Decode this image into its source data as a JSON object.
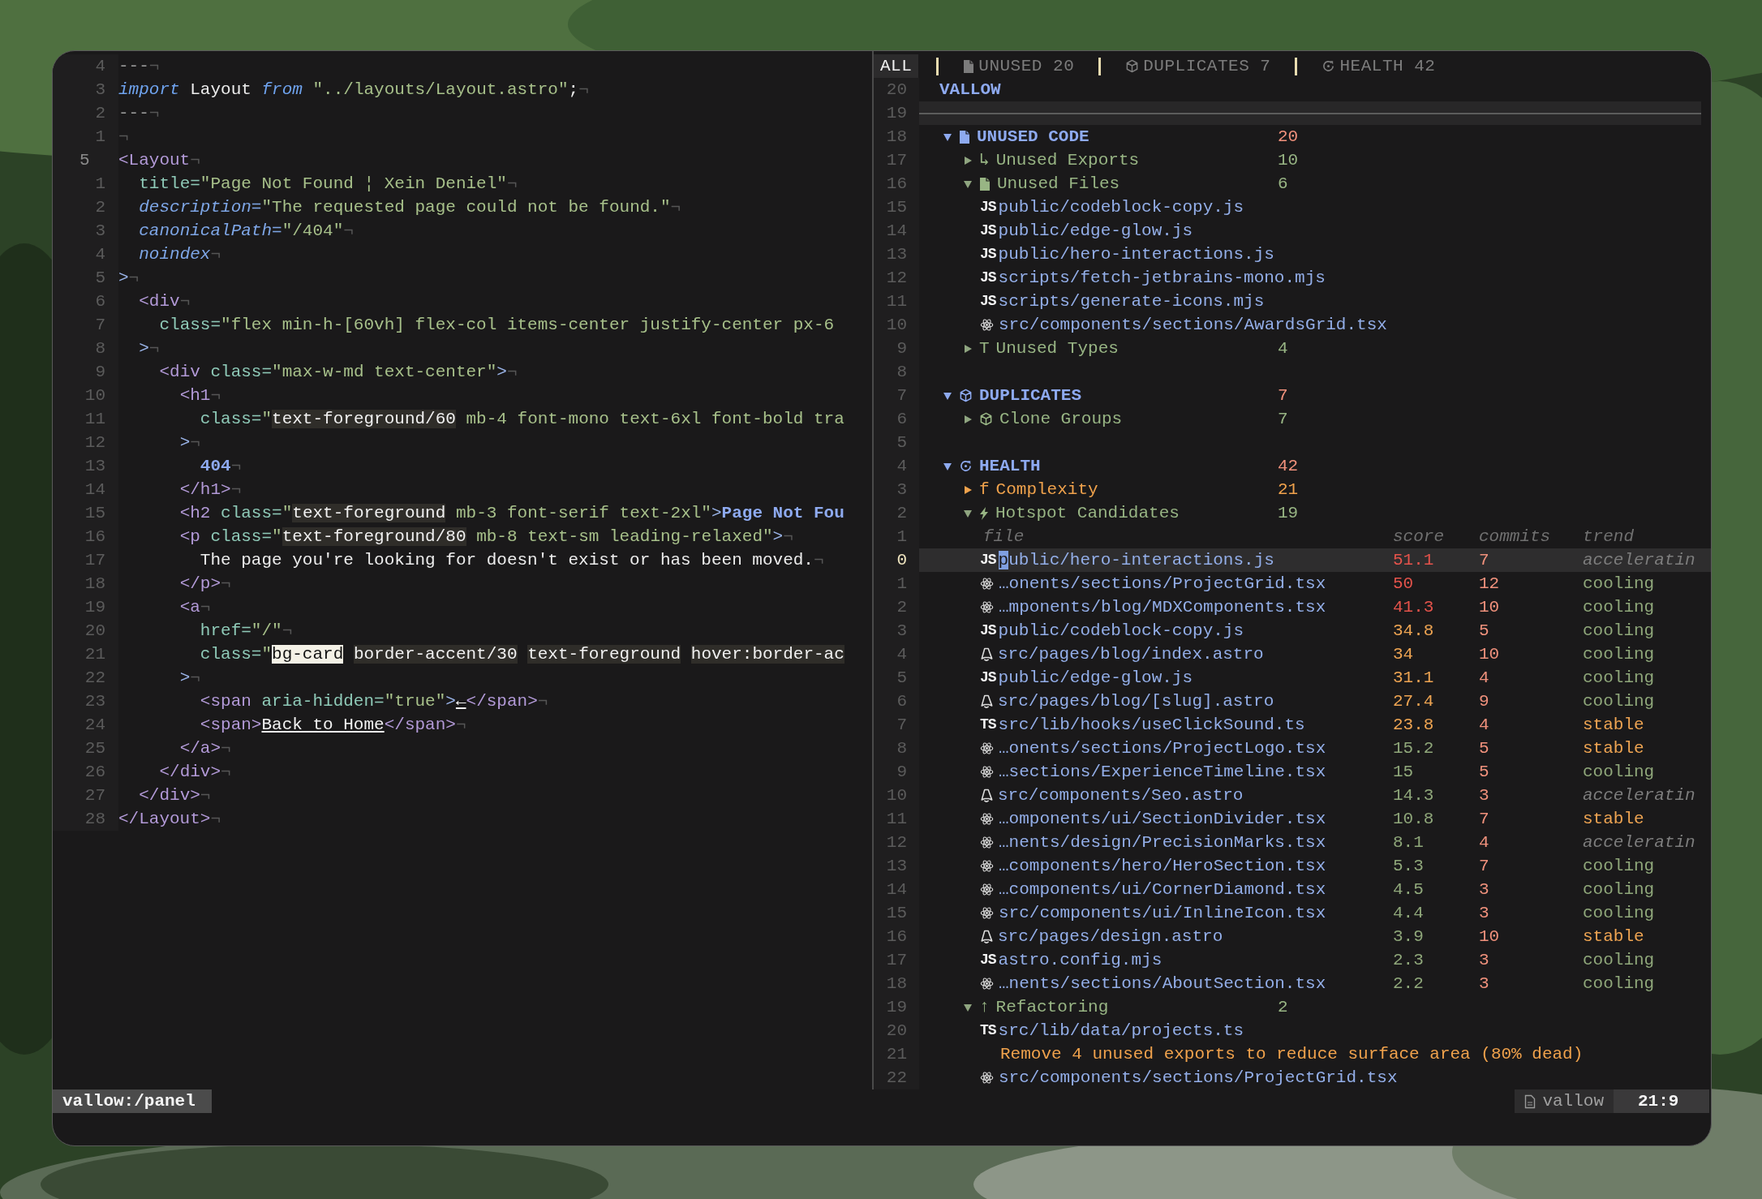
{
  "editor": {
    "lines": [
      {
        "n": "4",
        "current": false,
        "tokens": [
          {
            "text": "---",
            "kind": "dim"
          },
          {
            "text": "¬",
            "kind": "eol"
          }
        ]
      },
      {
        "n": "3",
        "current": false,
        "tokens": [
          {
            "text": "import",
            "kind": "kw"
          },
          {
            "text": " Layout ",
            "kind": "id"
          },
          {
            "text": "from",
            "kind": "kw"
          },
          {
            "text": " \"../layouts/Layout.astro\"",
            "kind": "str"
          },
          {
            "text": ";",
            "kind": "id"
          },
          {
            "text": "¬",
            "kind": "eol"
          }
        ]
      },
      {
        "n": "2",
        "current": false,
        "tokens": [
          {
            "text": "---",
            "kind": "dim"
          },
          {
            "text": "¬",
            "kind": "eol"
          }
        ]
      },
      {
        "n": "1",
        "current": false,
        "tokens": [
          {
            "text": "¬",
            "kind": "eol"
          }
        ]
      },
      {
        "n": "5",
        "current": true,
        "tokens": [
          {
            "text": "<Layout",
            "kind": "tag"
          },
          {
            "text": "¬",
            "kind": "eol"
          }
        ]
      },
      {
        "n": "1",
        "current": false,
        "tokens": [
          {
            "text": "  title=",
            "kind": "attr"
          },
          {
            "text": "\"Page Not Found ¦ Xein Deniel\"",
            "kind": "str"
          },
          {
            "text": "¬",
            "kind": "eol"
          }
        ]
      },
      {
        "n": "2",
        "current": false,
        "tokens": [
          {
            "text": "  description=",
            "kind": "attri"
          },
          {
            "text": "\"The requested page could not be found.\"",
            "kind": "str"
          },
          {
            "text": "¬",
            "kind": "eol"
          }
        ]
      },
      {
        "n": "3",
        "current": false,
        "tokens": [
          {
            "text": "  canonicalPath=",
            "kind": "attri"
          },
          {
            "text": "\"/404\"",
            "kind": "str"
          },
          {
            "text": "¬",
            "kind": "eol"
          }
        ]
      },
      {
        "n": "4",
        "current": false,
        "tokens": [
          {
            "text": "  noindex",
            "kind": "attri"
          },
          {
            "text": "¬",
            "kind": "eol"
          }
        ]
      },
      {
        "n": "5",
        "current": false,
        "tokens": [
          {
            "text": ">",
            "kind": "pun"
          },
          {
            "text": "¬",
            "kind": "eol"
          }
        ]
      },
      {
        "n": "6",
        "current": false,
        "tokens": [
          {
            "text": "  <div",
            "kind": "tag"
          },
          {
            "text": "¬",
            "kind": "eol"
          }
        ]
      },
      {
        "n": "7",
        "current": false,
        "tokens": [
          {
            "text": "    class=",
            "kind": "attr"
          },
          {
            "text": "\"flex min-h-[60vh] flex-col items-center justify-center px-6",
            "kind": "str"
          }
        ]
      },
      {
        "n": "8",
        "current": false,
        "tokens": [
          {
            "text": "  >",
            "kind": "pun"
          },
          {
            "text": "¬",
            "kind": "eol"
          }
        ]
      },
      {
        "n": "9",
        "current": false,
        "tokens": [
          {
            "text": "    <div",
            "kind": "tag"
          },
          {
            "text": " class=",
            "kind": "attr"
          },
          {
            "text": "\"max-w-md text-center\"",
            "kind": "str"
          },
          {
            "text": ">",
            "kind": "pun"
          },
          {
            "text": "¬",
            "kind": "eol"
          }
        ]
      },
      {
        "n": "10",
        "current": false,
        "tokens": [
          {
            "text": "      <h1",
            "kind": "tag"
          },
          {
            "text": "¬",
            "kind": "eol"
          }
        ]
      },
      {
        "n": "11",
        "current": false,
        "tokens": [
          {
            "text": "        class=",
            "kind": "attr"
          },
          {
            "text": "\"",
            "kind": "str"
          },
          {
            "text": "text-foreground/60",
            "kind": "hl"
          },
          {
            "text": " mb-4 font-mono text-6xl font-bold tra",
            "kind": "str"
          }
        ]
      },
      {
        "n": "12",
        "current": false,
        "tokens": [
          {
            "text": "      >",
            "kind": "pun"
          },
          {
            "text": "¬",
            "kind": "eol"
          }
        ]
      },
      {
        "n": "13",
        "current": false,
        "tokens": [
          {
            "text": "        404",
            "kind": "num"
          },
          {
            "text": "¬",
            "kind": "eol"
          }
        ]
      },
      {
        "n": "14",
        "current": false,
        "tokens": [
          {
            "text": "      </h1>",
            "kind": "tag"
          },
          {
            "text": "¬",
            "kind": "eol"
          }
        ]
      },
      {
        "n": "15",
        "current": false,
        "tokens": [
          {
            "text": "      <h2",
            "kind": "tag"
          },
          {
            "text": " class=",
            "kind": "attr"
          },
          {
            "text": "\"",
            "kind": "str"
          },
          {
            "text": "text-foreground",
            "kind": "hl"
          },
          {
            "text": " mb-3 font-serif text-2xl\"",
            "kind": "str"
          },
          {
            "text": ">",
            "kind": "pun"
          },
          {
            "text": "Page Not Fou",
            "kind": "num"
          }
        ]
      },
      {
        "n": "16",
        "current": false,
        "tokens": [
          {
            "text": "      <p",
            "kind": "tag"
          },
          {
            "text": " class=",
            "kind": "attr"
          },
          {
            "text": "\"",
            "kind": "str"
          },
          {
            "text": "text-foreground/80",
            "kind": "hl"
          },
          {
            "text": " mb-8 text-sm leading-relaxed\"",
            "kind": "str"
          },
          {
            "text": ">",
            "kind": "pun"
          },
          {
            "text": "¬",
            "kind": "eol"
          }
        ]
      },
      {
        "n": "17",
        "current": false,
        "tokens": [
          {
            "text": "        The page you're looking for doesn't exist or has been moved.",
            "kind": "txt"
          },
          {
            "text": "¬",
            "kind": "eol"
          }
        ]
      },
      {
        "n": "18",
        "current": false,
        "tokens": [
          {
            "text": "      </p>",
            "kind": "tag"
          },
          {
            "text": "¬",
            "kind": "eol"
          }
        ]
      },
      {
        "n": "19",
        "current": false,
        "tokens": [
          {
            "text": "      <a",
            "kind": "tag"
          },
          {
            "text": "¬",
            "kind": "eol"
          }
        ]
      },
      {
        "n": "20",
        "current": false,
        "tokens": [
          {
            "text": "        href=",
            "kind": "attr"
          },
          {
            "text": "\"/\"",
            "kind": "str"
          },
          {
            "text": "¬",
            "kind": "eol"
          }
        ]
      },
      {
        "n": "21",
        "current": false,
        "tokens": [
          {
            "text": "        class=",
            "kind": "attr"
          },
          {
            "text": "\"",
            "kind": "str"
          },
          {
            "text": "bg-card ",
            "kind": "hlw"
          },
          {
            "text": "border-accent/30 ",
            "kind": "hl"
          },
          {
            "text": "text-foreground ",
            "kind": "hl"
          },
          {
            "text": "hover:border-ac",
            "kind": "hl"
          }
        ]
      },
      {
        "n": "22",
        "current": false,
        "tokens": [
          {
            "text": "      >",
            "kind": "pun"
          },
          {
            "text": "¬",
            "kind": "eol"
          }
        ]
      },
      {
        "n": "23",
        "current": false,
        "tokens": [
          {
            "text": "        <span",
            "kind": "tag"
          },
          {
            "text": " aria-hidden=",
            "kind": "attr"
          },
          {
            "text": "\"true\"",
            "kind": "str"
          },
          {
            "text": ">",
            "kind": "pun"
          },
          {
            "text": "←",
            "kind": "u"
          },
          {
            "text": "</span>",
            "kind": "tag"
          },
          {
            "text": "¬",
            "kind": "eol"
          }
        ]
      },
      {
        "n": "24",
        "current": false,
        "tokens": [
          {
            "text": "        <span>",
            "kind": "tag"
          },
          {
            "text": "Back to Home",
            "kind": "u"
          },
          {
            "text": "</span>",
            "kind": "tag"
          },
          {
            "text": "¬",
            "kind": "eol"
          }
        ]
      },
      {
        "n": "25",
        "current": false,
        "tokens": [
          {
            "text": "      </a>",
            "kind": "tag"
          },
          {
            "text": "¬",
            "kind": "eol"
          }
        ]
      },
      {
        "n": "26",
        "current": false,
        "tokens": [
          {
            "text": "    </div>",
            "kind": "tag"
          },
          {
            "text": "¬",
            "kind": "eol"
          }
        ]
      },
      {
        "n": "27",
        "current": false,
        "tokens": [
          {
            "text": "  </div>",
            "kind": "tag"
          },
          {
            "text": "¬",
            "kind": "eol"
          }
        ]
      },
      {
        "n": "28",
        "current": false,
        "tokens": [
          {
            "text": "</Layout>",
            "kind": "tag"
          },
          {
            "text": "¬",
            "kind": "eol"
          }
        ]
      }
    ]
  },
  "panel": {
    "tabs": [
      {
        "kind": "all",
        "label": "ALL",
        "selected": true
      },
      {
        "kind": "unused",
        "label": "UNUSED 20",
        "selected": false
      },
      {
        "kind": "duplicates",
        "label": "DUPLICATES 7",
        "selected": false
      },
      {
        "kind": "health",
        "label": "HEALTH 42",
        "selected": false
      }
    ],
    "rows": [
      {
        "n": "20",
        "kind": "title",
        "text": "VALLOW"
      },
      {
        "n": "19",
        "kind": "rule"
      },
      {
        "n": "18",
        "kind": "section",
        "icon": {
          "kind": "file"
        },
        "label": "UNUSED CODE",
        "count": "20",
        "expanded": true
      },
      {
        "n": "17",
        "kind": "group",
        "icon": {
          "kind": "glyph",
          "text": "↳"
        },
        "label": "Unused Exports",
        "count": "10",
        "expanded": false,
        "warning": false
      },
      {
        "n": "16",
        "kind": "group",
        "icon": {
          "kind": "file"
        },
        "label": "Unused Files",
        "count": "6",
        "expanded": true,
        "warning": false
      },
      {
        "n": "15",
        "kind": "file",
        "icon": {
          "kind": "badge",
          "text": "JS"
        },
        "path": "public/codeblock-copy.js"
      },
      {
        "n": "14",
        "kind": "file",
        "icon": {
          "kind": "badge",
          "text": "JS"
        },
        "path": "public/edge-glow.js"
      },
      {
        "n": "13",
        "kind": "file",
        "icon": {
          "kind": "badge",
          "text": "JS"
        },
        "path": "public/hero-interactions.js"
      },
      {
        "n": "12",
        "kind": "file",
        "icon": {
          "kind": "badge",
          "text": "JS"
        },
        "path": "scripts/fetch-jetbrains-mono.mjs"
      },
      {
        "n": "11",
        "kind": "file",
        "icon": {
          "kind": "badge",
          "text": "JS"
        },
        "path": "scripts/generate-icons.mjs"
      },
      {
        "n": "10",
        "kind": "file",
        "icon": {
          "kind": "react"
        },
        "path": "src/components/sections/AwardsGrid.tsx"
      },
      {
        "n": "9",
        "kind": "group",
        "icon": {
          "kind": "glyph",
          "text": "T"
        },
        "label": "Unused Types",
        "count": "4",
        "expanded": false,
        "warning": false
      },
      {
        "n": "8",
        "kind": "blank"
      },
      {
        "n": "7",
        "kind": "section",
        "icon": {
          "kind": "cube"
        },
        "label": "DUPLICATES",
        "count": "7",
        "expanded": true
      },
      {
        "n": "6",
        "kind": "group",
        "icon": {
          "kind": "cube"
        },
        "label": "Clone Groups",
        "count": "7",
        "expanded": false,
        "warning": false
      },
      {
        "n": "5",
        "kind": "blank"
      },
      {
        "n": "4",
        "kind": "section",
        "icon": {
          "kind": "health"
        },
        "label": "HEALTH",
        "count": "42",
        "expanded": true
      },
      {
        "n": "3",
        "kind": "group",
        "icon": {
          "kind": "glyph",
          "text": "f"
        },
        "label": "Complexity",
        "count": "21",
        "expanded": false,
        "warning": true
      },
      {
        "n": "2",
        "kind": "group",
        "icon": {
          "kind": "bolt"
        },
        "label": "Hotspot Candidates",
        "count": "19",
        "expanded": true,
        "warning": false
      },
      {
        "n": "1",
        "kind": "header",
        "columns": [
          "file",
          "score",
          "commits",
          "trend"
        ]
      },
      {
        "n": "0",
        "kind": "hotspot",
        "selected": true,
        "icon": {
          "kind": "badge",
          "text": "JS"
        },
        "path": "public/hero-interactions.js",
        "score": {
          "text": "51.1",
          "kind": "high"
        },
        "commits": "7",
        "trend": {
          "text": "acceleratin",
          "kind": "rising"
        }
      },
      {
        "n": "1",
        "kind": "hotspot",
        "selected": false,
        "icon": {
          "kind": "react"
        },
        "path": "…onents/sections/ProjectGrid.tsx",
        "score": {
          "text": "50",
          "kind": "high"
        },
        "commits": "12",
        "trend": {
          "text": "cooling",
          "kind": "falling"
        }
      },
      {
        "n": "2",
        "kind": "hotspot",
        "selected": false,
        "icon": {
          "kind": "react"
        },
        "path": "…mponents/blog/MDXComponents.tsx",
        "score": {
          "text": "41.3",
          "kind": "high"
        },
        "commits": "10",
        "trend": {
          "text": "cooling",
          "kind": "falling"
        }
      },
      {
        "n": "3",
        "kind": "hotspot",
        "selected": false,
        "icon": {
          "kind": "badge",
          "text": "JS"
        },
        "path": "public/codeblock-copy.js",
        "score": {
          "text": "34.8",
          "kind": "medium"
        },
        "commits": "5",
        "trend": {
          "text": "cooling",
          "kind": "falling"
        }
      },
      {
        "n": "4",
        "kind": "hotspot",
        "selected": false,
        "icon": {
          "kind": "astro"
        },
        "path": "src/pages/blog/index.astro",
        "score": {
          "text": "34",
          "kind": "medium"
        },
        "commits": "10",
        "trend": {
          "text": "cooling",
          "kind": "falling"
        }
      },
      {
        "n": "5",
        "kind": "hotspot",
        "selected": false,
        "icon": {
          "kind": "badge",
          "text": "JS"
        },
        "path": "public/edge-glow.js",
        "score": {
          "text": "31.1",
          "kind": "medium"
        },
        "commits": "4",
        "trend": {
          "text": "cooling",
          "kind": "falling"
        }
      },
      {
        "n": "6",
        "kind": "hotspot",
        "selected": false,
        "icon": {
          "kind": "astro"
        },
        "path": "src/pages/blog/[slug].astro",
        "score": {
          "text": "27.4",
          "kind": "medium"
        },
        "commits": "9",
        "trend": {
          "text": "cooling",
          "kind": "falling"
        }
      },
      {
        "n": "7",
        "kind": "hotspot",
        "selected": false,
        "icon": {
          "kind": "badge",
          "text": "TS"
        },
        "path": "src/lib/hooks/useClickSound.ts",
        "score": {
          "text": "23.8",
          "kind": "medium"
        },
        "commits": "4",
        "trend": {
          "text": "stable",
          "kind": "flat"
        }
      },
      {
        "n": "8",
        "kind": "hotspot",
        "selected": false,
        "icon": {
          "kind": "react"
        },
        "path": "…onents/sections/ProjectLogo.tsx",
        "score": {
          "text": "15.2",
          "kind": "low"
        },
        "commits": "5",
        "trend": {
          "text": "stable",
          "kind": "flat"
        }
      },
      {
        "n": "9",
        "kind": "hotspot",
        "selected": false,
        "icon": {
          "kind": "react"
        },
        "path": "…sections/ExperienceTimeline.tsx",
        "score": {
          "text": "15",
          "kind": "low"
        },
        "commits": "5",
        "trend": {
          "text": "cooling",
          "kind": "falling"
        }
      },
      {
        "n": "10",
        "kind": "hotspot",
        "selected": false,
        "icon": {
          "kind": "astro"
        },
        "path": "src/components/Seo.astro",
        "score": {
          "text": "14.3",
          "kind": "low"
        },
        "commits": "3",
        "trend": {
          "text": "acceleratin",
          "kind": "rising"
        }
      },
      {
        "n": "11",
        "kind": "hotspot",
        "selected": false,
        "icon": {
          "kind": "react"
        },
        "path": "…omponents/ui/SectionDivider.tsx",
        "score": {
          "text": "10.8",
          "kind": "low"
        },
        "commits": "7",
        "trend": {
          "text": "stable",
          "kind": "flat"
        }
      },
      {
        "n": "12",
        "kind": "hotspot",
        "selected": false,
        "icon": {
          "kind": "react"
        },
        "path": "…nents/design/PrecisionMarks.tsx",
        "score": {
          "text": "8.1",
          "kind": "low"
        },
        "commits": "4",
        "trend": {
          "text": "acceleratin",
          "kind": "rising"
        }
      },
      {
        "n": "13",
        "kind": "hotspot",
        "selected": false,
        "icon": {
          "kind": "react"
        },
        "path": "…components/hero/HeroSection.tsx",
        "score": {
          "text": "5.3",
          "kind": "low"
        },
        "commits": "7",
        "trend": {
          "text": "cooling",
          "kind": "falling"
        }
      },
      {
        "n": "14",
        "kind": "hotspot",
        "selected": false,
        "icon": {
          "kind": "react"
        },
        "path": "…components/ui/CornerDiamond.tsx",
        "score": {
          "text": "4.5",
          "kind": "low"
        },
        "commits": "3",
        "trend": {
          "text": "cooling",
          "kind": "falling"
        }
      },
      {
        "n": "15",
        "kind": "hotspot",
        "selected": false,
        "icon": {
          "kind": "react"
        },
        "path": "src/components/ui/InlineIcon.tsx",
        "score": {
          "text": "4.4",
          "kind": "low"
        },
        "commits": "3",
        "trend": {
          "text": "cooling",
          "kind": "falling"
        }
      },
      {
        "n": "16",
        "kind": "hotspot",
        "selected": false,
        "icon": {
          "kind": "astro"
        },
        "path": "src/pages/design.astro",
        "score": {
          "text": "3.9",
          "kind": "low"
        },
        "commits": "10",
        "trend": {
          "text": "stable",
          "kind": "flat"
        }
      },
      {
        "n": "17",
        "kind": "hotspot",
        "selected": false,
        "icon": {
          "kind": "badge",
          "text": "JS"
        },
        "path": "astro.config.mjs",
        "score": {
          "text": "2.3",
          "kind": "low"
        },
        "commits": "3",
        "trend": {
          "text": "cooling",
          "kind": "falling"
        }
      },
      {
        "n": "18",
        "kind": "hotspot",
        "selected": false,
        "icon": {
          "kind": "react"
        },
        "path": "…nents/sections/AboutSection.tsx",
        "score": {
          "text": "2.2",
          "kind": "low"
        },
        "commits": "3",
        "trend": {
          "text": "cooling",
          "kind": "falling"
        }
      },
      {
        "n": "19",
        "kind": "group",
        "icon": {
          "kind": "glyph",
          "text": "↑"
        },
        "label": "Refactoring",
        "count": "2",
        "expanded": true,
        "warning": false
      },
      {
        "n": "20",
        "kind": "file",
        "icon": {
          "kind": "badge",
          "text": "TS"
        },
        "path": "src/lib/data/projects.ts"
      },
      {
        "n": "21",
        "kind": "note",
        "text": "Remove 4 unused exports to reduce surface area (80% dead)"
      },
      {
        "n": "22",
        "kind": "file",
        "icon": {
          "kind": "react"
        },
        "path": "src/components/sections/ProjectGrid.tsx"
      }
    ]
  },
  "status_bar": {
    "mode": "vallow:/panel",
    "file": "vallow",
    "position": "21:9"
  }
}
